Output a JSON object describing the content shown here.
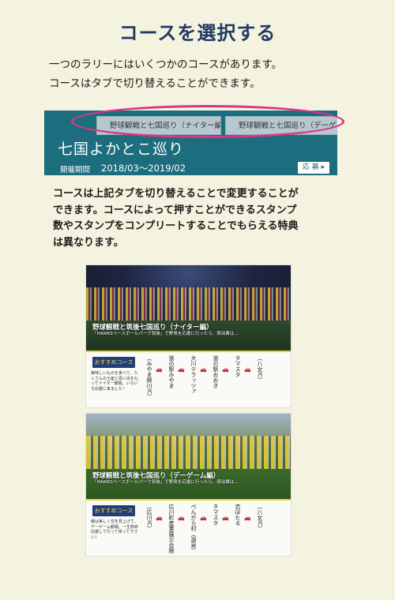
{
  "page": {
    "title": "コースを選択する",
    "intro_lines": [
      "一つのラリーにはいくつかのコースがあります。",
      "コースはタブで切り替えることができます。"
    ],
    "description_lines": [
      "コースは上記タブを切り替えることで変更することが",
      "できます。コースによって押すことができるスタンプ",
      "数やスタンプをコンプリートすることでもらえる特典",
      "は異なります。"
    ]
  },
  "tabs_panel": {
    "tabs": [
      "野球観戦と七国巡り（ナイター編）",
      "野球観戦と七国巡り（デーゲ"
    ],
    "rally_title": "七国よかとこ巡り",
    "period_label": "開催期間",
    "period_value": "2018/03〜2019/02",
    "apply_label": "応 募 ▸",
    "accent_color": "#1c6d7d",
    "highlight_color": "#d83686"
  },
  "courses": [
    {
      "title": "野球観戦と筑後七国巡り（ナイター編）",
      "text": "「HAWKSベースボールパーク筑後」で野鳥を応援に行ったら、宿泊費は…",
      "badge": "おすすめコース",
      "rec_text": "美味しいものを食べて、たくさんの土産と思い出をもってナイター観戦。いろいろ応援に来ました！",
      "stops": [
        "（みやま柳川IC）",
        "道の駅みやま",
        "大川テラッツァ",
        "道の駅おおき",
        "タマスタ",
        "（八女IC）"
      ]
    },
    {
      "title": "野球観戦と筑後七国巡り（デーゲーム編）",
      "text": "「HAWKSベースボールパーク筑後」で野鳥を応援に行ったら、宿泊費は…",
      "badge": "おすすめコース",
      "rec_text": "朝は美しく空を見上げて、デーゲーム観戦。一生懸命応援して行って帰って下さい！",
      "stops": [
        "（広川IC）",
        "広川町産業展示会館",
        "べんがら村（源泉）",
        "タマスタ",
        "恋ぼたる",
        "（八女IC）"
      ]
    }
  ]
}
